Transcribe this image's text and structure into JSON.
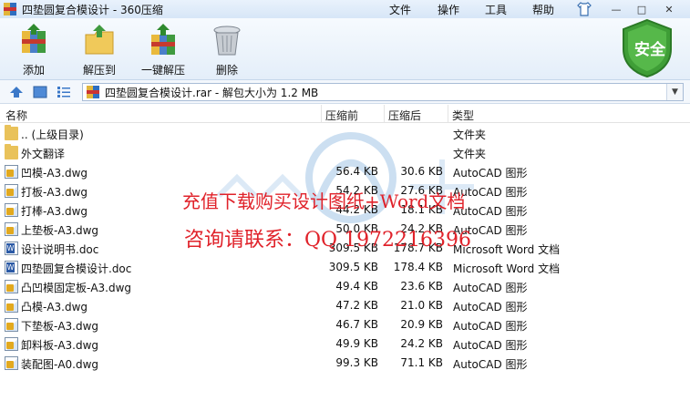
{
  "window": {
    "title": "四垫圆复合模设计 - 360压缩",
    "menu": [
      "文件",
      "操作",
      "工具",
      "帮助"
    ],
    "controls": {
      "minimize": "—",
      "maximize": "□",
      "close": "✕"
    }
  },
  "toolbar": {
    "add": "添加",
    "extract_to": "解压到",
    "one_click_extract": "一键解压",
    "delete": "删除",
    "security_badge": "安全"
  },
  "address": {
    "path": "四垫圆复合模设计.rar - 解包大小为 1.2 MB"
  },
  "columns": {
    "name": "名称",
    "compressed_before": "压缩前",
    "compressed_after": "压缩后",
    "type": "类型"
  },
  "files": [
    {
      "name": ".. (上级目录)",
      "before": "",
      "after": "",
      "type": "文件夹",
      "icon": "folder-icon"
    },
    {
      "name": "外文翻译",
      "before": "",
      "after": "",
      "type": "文件夹",
      "icon": "folder-icon"
    },
    {
      "name": "凹模-A3.dwg",
      "before": "56.4 KB",
      "after": "30.6 KB",
      "type": "AutoCAD 图形",
      "icon": "dwg-file-icon"
    },
    {
      "name": "打板-A3.dwg",
      "before": "54.2 KB",
      "after": "27.6 KB",
      "type": "AutoCAD 图形",
      "icon": "dwg-file-icon"
    },
    {
      "name": "打棒-A3.dwg",
      "before": "44.2 KB",
      "after": "18.1 KB",
      "type": "AutoCAD 图形",
      "icon": "dwg-file-icon"
    },
    {
      "name": "上垫板-A3.dwg",
      "before": "50.0 KB",
      "after": "24.2 KB",
      "type": "AutoCAD 图形",
      "icon": "dwg-file-icon"
    },
    {
      "name": "设计说明书.doc",
      "before": "309.5 KB",
      "after": "178.7 KB",
      "type": "Microsoft Word 文档",
      "icon": "doc-file-icon"
    },
    {
      "name": "四垫圆复合模设计.doc",
      "before": "309.5 KB",
      "after": "178.4 KB",
      "type": "Microsoft Word 文档",
      "icon": "doc-file-icon"
    },
    {
      "name": "凸凹模固定板-A3.dwg",
      "before": "49.4 KB",
      "after": "23.6 KB",
      "type": "AutoCAD 图形",
      "icon": "dwg-file-icon"
    },
    {
      "name": "凸模-A3.dwg",
      "before": "47.2 KB",
      "after": "21.0 KB",
      "type": "AutoCAD 图形",
      "icon": "dwg-file-icon"
    },
    {
      "name": "下垫板-A3.dwg",
      "before": "46.7 KB",
      "after": "20.9 KB",
      "type": "AutoCAD 图形",
      "icon": "dwg-file-icon"
    },
    {
      "name": "卸料板-A3.dwg",
      "before": "49.9 KB",
      "after": "24.2 KB",
      "type": "AutoCAD 图形",
      "icon": "dwg-file-icon"
    },
    {
      "name": "装配图-A0.dwg",
      "before": "99.3 KB",
      "after": "71.1 KB",
      "type": "AutoCAD 图形",
      "icon": "dwg-file-icon"
    }
  ],
  "watermark": {
    "line1": "充值下载购买设计图纸+Word文档",
    "line2": "咨询请联系：QQ 1972216396",
    "color": "#e0222a"
  }
}
